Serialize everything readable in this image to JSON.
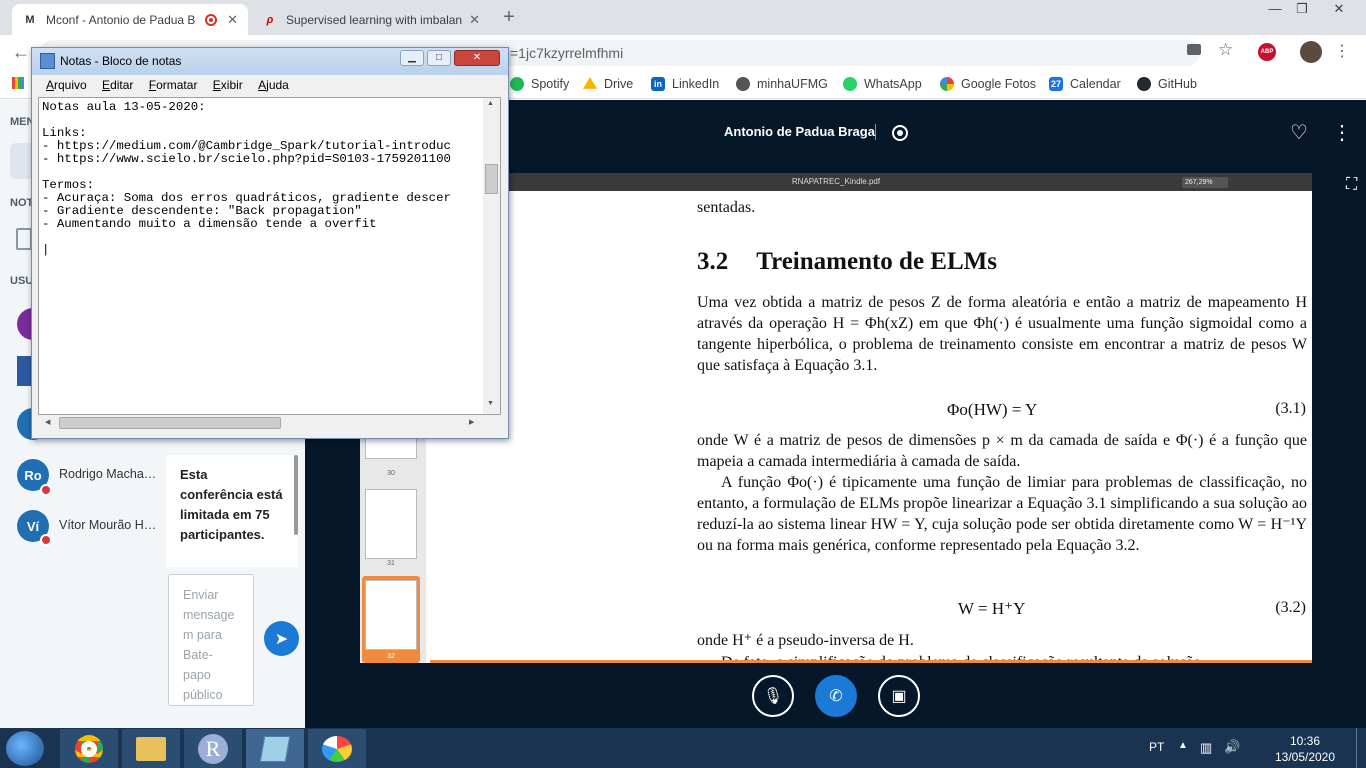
{
  "browser": {
    "tabs": [
      {
        "favicon": "M",
        "title": "Mconf - Antonio de Padua B",
        "active": true
      },
      {
        "favicon": "ρ",
        "title": "Supervised learning with imbalan",
        "active": false
      }
    ],
    "url_fragment": "=1jc7kzyrrelmfhmi",
    "bookmarks": [
      "Spotify",
      "Drive",
      "LinkedIn",
      "minhaUFMG",
      "WhatsApp",
      "Google Fotos",
      "Calendar",
      "GitHub"
    ],
    "bookmark_colors": [
      "#1db954",
      "#f4b400",
      "#0a66c2",
      "#555555",
      "#25d366",
      "#ea4335",
      "#1a73e8",
      "#24292e"
    ],
    "calendar_day": "27",
    "abp_badge": "ABP"
  },
  "sidebar": {
    "menu_label": "MEN",
    "notes_label": "NOT",
    "users_label": "USU",
    "users": [
      {
        "initials": "Ro",
        "name": "Rodrigo Macha…",
        "color": "#1f6fb2"
      },
      {
        "initials": "Ví",
        "name": "Vítor Mourão H…",
        "color": "#1f6fb2"
      }
    ],
    "conference_notice": "Esta conferência está limitada em 75 participantes.",
    "chat_placeholder": "Enviar mensagem para Bate-papo público"
  },
  "conference": {
    "presenter_name": "Antonio de Padua Braga"
  },
  "pdf": {
    "filename": "RNAPATREC_Kindle.pdf",
    "zoom": "267,29%",
    "thumbnail_pages": [
      "30",
      "31",
      "32"
    ],
    "top_fragment": "sentadas.",
    "section_number": "3.2",
    "section_title": "Treinamento de ELMs",
    "paragraph1": "Uma vez obtida a matriz de pesos Z de forma aleatória e então a matriz de mapeamento H através da operação H = Φh(xZ) em que Φh(·) é usualmente uma função sigmoidal como a tangente hiperbólica, o problema de treinamento consiste em encontrar a matriz de pesos W que satisfaça à Equação 3.1.",
    "equation1": "Φo(HW) = Y",
    "equation1_number": "(3.1)",
    "paragraph2": "onde W é a matriz de pesos de dimensões p × m da camada de saída e Φ(·) é a função que mapeia a camada intermediária à camada de saída.",
    "paragraph3": "A função Φo(·) é tipicamente uma função de limiar para problemas de classificação, no entanto, a formulação de ELMs propõe linearizar a Equação 3.1 simplificando a sua solução ao reduzí-la ao sistema linear HW = Y, cuja solução pode ser obtida diretamente como W = H⁻¹Y ou na forma mais genérica, conforme representado pela Equação 3.2.",
    "equation2": "W = H⁺Y",
    "equation2_number": "(3.2)",
    "paragraph4": "onde H⁺ é a pseudo-inversa de H.",
    "paragraph5": "De fato, a simplificação do problema de classificação resultante da solução"
  },
  "notepad": {
    "title": "Notas - Bloco de notas",
    "menu": [
      {
        "label": "Arquivo",
        "key": "A",
        "rest": "rquivo"
      },
      {
        "label": "Editar",
        "key": "E",
        "rest": "ditar"
      },
      {
        "label": "Formatar",
        "key": "F",
        "rest": "ormatar"
      },
      {
        "label": "Exibir",
        "key": "E",
        "rest": "xibir"
      },
      {
        "label": "Ajuda",
        "key": "A",
        "rest": "juda"
      }
    ],
    "content": "Notas aula 13-05-2020:\n\nLinks:\n- https://medium.com/@Cambridge_Spark/tutorial-introduc\n- https://www.scielo.br/scielo.php?pid=S0103-1759201100\n\nTermos:\n- Acuraça: Soma dos erros quadráticos, gradiente descer\n- Gradiente descendente: \"Back propagation\"\n- Aumentando muito a dimensão tende a overfit\n\n|"
  },
  "taskbar": {
    "language": "PT",
    "time": "10:36",
    "date": "13/05/2020",
    "apps": [
      "chrome",
      "file-explorer",
      "r",
      "notepad",
      "paint"
    ]
  }
}
